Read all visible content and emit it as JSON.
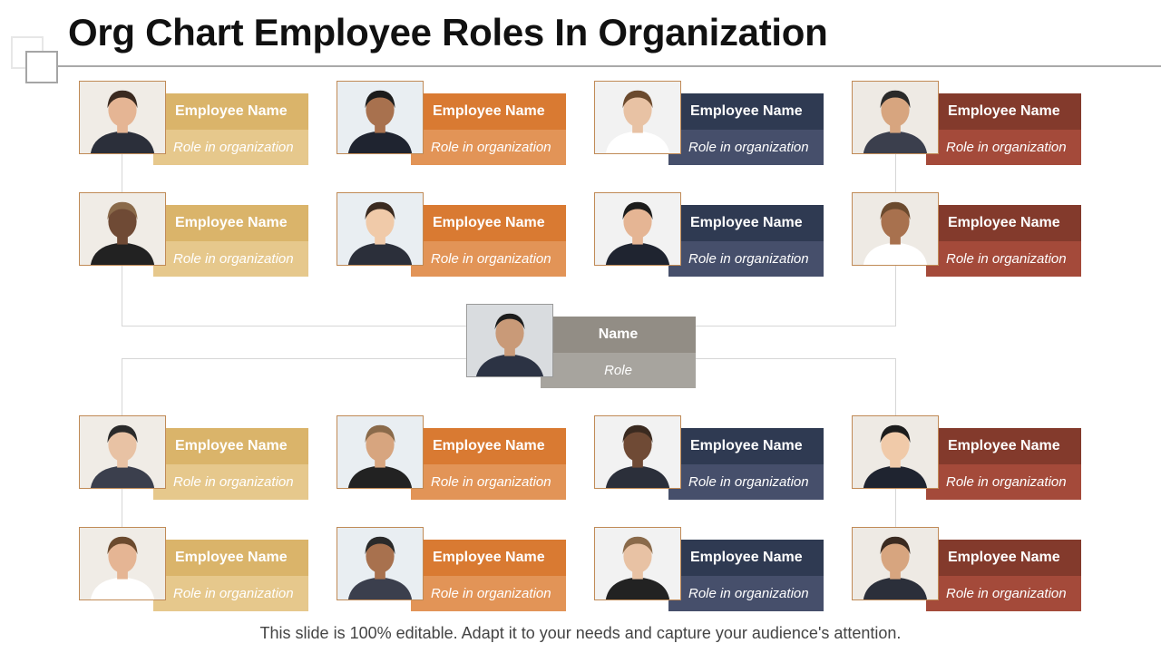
{
  "title": "Org Chart Employee Roles In Organization",
  "center": {
    "name": "Name",
    "role": "Role"
  },
  "employees": [
    {
      "name": "Employee Name",
      "role": "Role in organization",
      "color": "gold"
    },
    {
      "name": "Employee Name",
      "role": "Role in organization",
      "color": "orange"
    },
    {
      "name": "Employee Name",
      "role": "Role in organization",
      "color": "navy"
    },
    {
      "name": "Employee Name",
      "role": "Role in organization",
      "color": "rust"
    },
    {
      "name": "Employee Name",
      "role": "Role in organization",
      "color": "gold"
    },
    {
      "name": "Employee Name",
      "role": "Role in organization",
      "color": "orange"
    },
    {
      "name": "Employee Name",
      "role": "Role in organization",
      "color": "navy"
    },
    {
      "name": "Employee Name",
      "role": "Role in organization",
      "color": "rust"
    },
    {
      "name": "Employee Name",
      "role": "Role in organization",
      "color": "gold"
    },
    {
      "name": "Employee Name",
      "role": "Role in organization",
      "color": "orange"
    },
    {
      "name": "Employee Name",
      "role": "Role in organization",
      "color": "navy"
    },
    {
      "name": "Employee Name",
      "role": "Role in organization",
      "color": "rust"
    },
    {
      "name": "Employee Name",
      "role": "Role in organization",
      "color": "gold"
    },
    {
      "name": "Employee Name",
      "role": "Role in organization",
      "color": "orange"
    },
    {
      "name": "Employee Name",
      "role": "Role in organization",
      "color": "navy"
    },
    {
      "name": "Employee Name",
      "role": "Role in organization",
      "color": "rust"
    }
  ],
  "footer": "This slide is 100% editable. Adapt it to your needs and capture your audience's attention.",
  "colors": {
    "gold": "#dab46a",
    "orange": "#d97a32",
    "navy": "#2f3a52",
    "rust": "#833a2c",
    "gray": "#928d85"
  }
}
